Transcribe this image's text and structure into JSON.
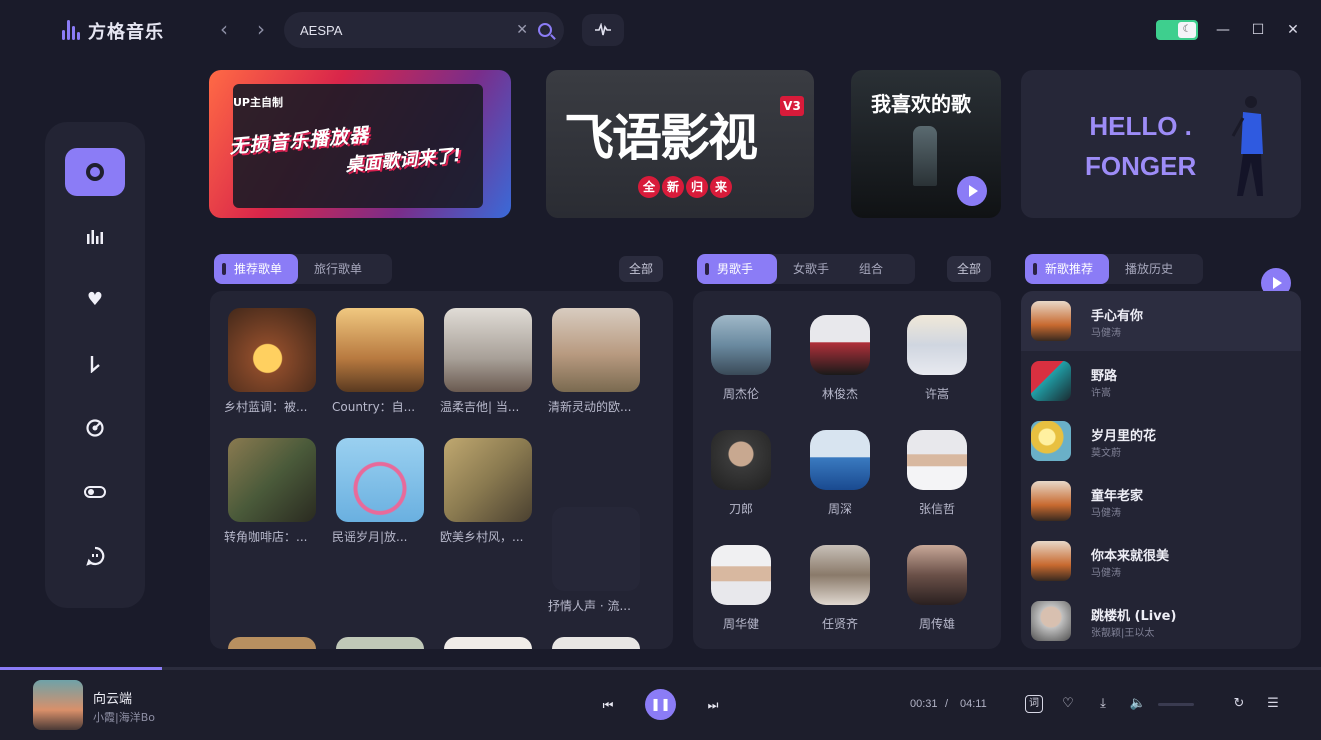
{
  "app": {
    "name": "方格音乐"
  },
  "search": {
    "value": "AESPA"
  },
  "banners": {
    "b1": {
      "tag": "UP主自制",
      "line1": "无损音乐播放器",
      "line2": "桌面歌词来了!"
    },
    "b2": {
      "title": "飞语影视",
      "version": "V3",
      "sub": [
        "全",
        "新",
        "归",
        "来"
      ]
    },
    "b3": {
      "title": "我喜欢的歌"
    },
    "b4": {
      "line1": "HELLO .",
      "line2": "FONGER"
    }
  },
  "playlists": {
    "tabs": [
      "推荐歌单",
      "旅行歌单"
    ],
    "all_label": "全部",
    "items": [
      {
        "name": "乡村蓝调：被...",
        "color": "#8a4a2a"
      },
      {
        "name": "Country：自...",
        "color": "#c98a4a"
      },
      {
        "name": "温柔吉他| 当...",
        "color": "#c0b8b0"
      },
      {
        "name": "清新灵动的欧...",
        "color": "#b89a80"
      },
      {
        "name": "转角咖啡店：...",
        "color": "#5a6a4a"
      },
      {
        "name": "民谣岁月|放...",
        "color": "#7ab6d8"
      },
      {
        "name": "欧美乡村风，...",
        "color": "#8a7a50"
      },
      {
        "name": "抒情人声 · 流...",
        "color": "#262738"
      }
    ]
  },
  "singers": {
    "tabs": [
      "男歌手",
      "女歌手",
      "组合"
    ],
    "all_label": "全部",
    "items": [
      {
        "name": "周杰伦",
        "color": "#6a8aa0"
      },
      {
        "name": "林俊杰",
        "color": "#b0303a"
      },
      {
        "name": "许嵩",
        "color": "#d0d6e0"
      },
      {
        "name": "刀郎",
        "color": "#3a3a3a"
      },
      {
        "name": "周深",
        "color": "#3a7ac0"
      },
      {
        "name": "张信哲",
        "color": "#c8c8cc"
      },
      {
        "name": "周华健",
        "color": "#d8d8dc"
      },
      {
        "name": "任贤齐",
        "color": "#8a7a6a"
      },
      {
        "name": "周传雄",
        "color": "#6a5048"
      }
    ]
  },
  "songs": {
    "tabs": [
      "新歌推荐",
      "播放历史"
    ],
    "items": [
      {
        "title": "手心有你",
        "artist": "马健涛",
        "color": "#c86a30"
      },
      {
        "title": "野路",
        "artist": "许嵩",
        "color": "#20a0a8"
      },
      {
        "title": "岁月里的花",
        "artist": "莫文蔚",
        "color": "#e8c040"
      },
      {
        "title": "童年老家",
        "artist": "马健涛",
        "color": "#c86a30"
      },
      {
        "title": "你本来就很美",
        "artist": "马健涛",
        "color": "#c86a30"
      },
      {
        "title": "跳楼机 (Live)",
        "artist": "张靓颖|王以太",
        "color": "#c0c0c0"
      }
    ]
  },
  "player": {
    "title": "向云端",
    "artist": "小霞|海洋Bo",
    "current_time": "00:31",
    "separator": "/",
    "total_time": "04:11",
    "progress": 0.123,
    "lyric_label": "词"
  },
  "colors": {
    "accent": "#8b7cf6",
    "bg": "#1a1b2a",
    "panel": "#232434"
  }
}
